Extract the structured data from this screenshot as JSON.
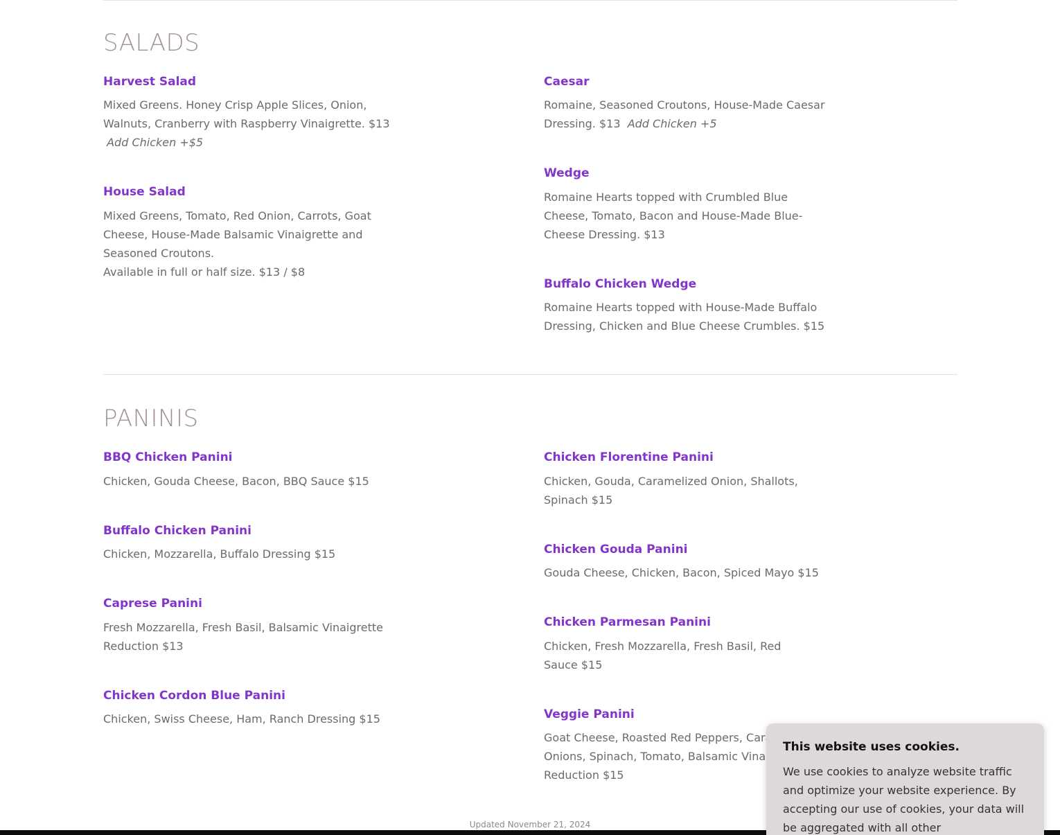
{
  "salads": {
    "title": "SALADS",
    "left": [
      {
        "name": "Harvest Salad",
        "desc": "Mixed Greens. Honey Crisp Apple Slices, Onion, Walnuts, Cranberry with Raspberry Vinaigrette. $13",
        "addon": "Add Chicken +$5"
      },
      {
        "name": "House Salad",
        "desc": "Mixed Greens, Tomato, Red Onion, Carrots, Goat Cheese, House-Made Balsamic Vinaigrette and Seasoned Croutons.",
        "desc2": "Available in full or half size. $13 / $8"
      }
    ],
    "right": [
      {
        "name": "Caesar",
        "desc": "Romaine, Seasoned Croutons, House-Made Caesar Dressing. $13",
        "addon": "Add Chicken +5"
      },
      {
        "name": "Wedge",
        "desc": "Romaine Hearts topped with Crumbled Blue Cheese, Tomato, Bacon and House-Made Blue-Cheese Dressing. $13"
      },
      {
        "name": "Buffalo Chicken Wedge",
        "desc": "Romaine Hearts topped with House-Made Buffalo Dressing, Chicken and Blue Cheese Crumbles.  $15"
      }
    ]
  },
  "paninis": {
    "title": "PANINIS",
    "left": [
      {
        "name": "BBQ Chicken Panini",
        "desc": "Chicken, Gouda Cheese, Bacon, BBQ Sauce $15"
      },
      {
        "name": "Buffalo Chicken Panini",
        "desc": "Chicken, Mozzarella, Buffalo Dressing $15"
      },
      {
        "name": "Caprese Panini",
        "desc": "Fresh Mozzarella, Fresh Basil, Balsamic Vinaigrette Reduction $13"
      },
      {
        "name": "Chicken Cordon Blue Panini",
        "desc": "Chicken, Swiss Cheese, Ham, Ranch Dressing $15"
      }
    ],
    "right": [
      {
        "name": "Chicken Florentine Panini",
        "desc": "Chicken, Gouda, Caramelized Onion, Shallots, Spinach  $15"
      },
      {
        "name": "Chicken Gouda Panini",
        "desc": "Gouda Cheese, Chicken, Bacon, Spiced Mayo  $15"
      },
      {
        "name": "Chicken Parmesan Panini",
        "desc": "Chicken, Fresh Mozzarella, Fresh Basil, Red Sauce $15"
      },
      {
        "name": "Veggie Panini",
        "desc": "Goat Cheese, Roasted Red Peppers, Caramelized Onions, Spinach, Tomato, Balsamic Vinaigrette Reduction  $15"
      }
    ]
  },
  "footer": {
    "updated": "Updated November 21, 2024"
  },
  "cookie": {
    "title": "This website uses cookies.",
    "body": "We use cookies to analyze website traffic and optimize your website experience. By accepting our use of cookies, your data will be aggregated with all other"
  },
  "colors": {
    "item_name": "#8236c9",
    "section_title": "#a2919d",
    "body_text": "#6b6b6b",
    "cookie_bg": "#ddd8dc"
  }
}
